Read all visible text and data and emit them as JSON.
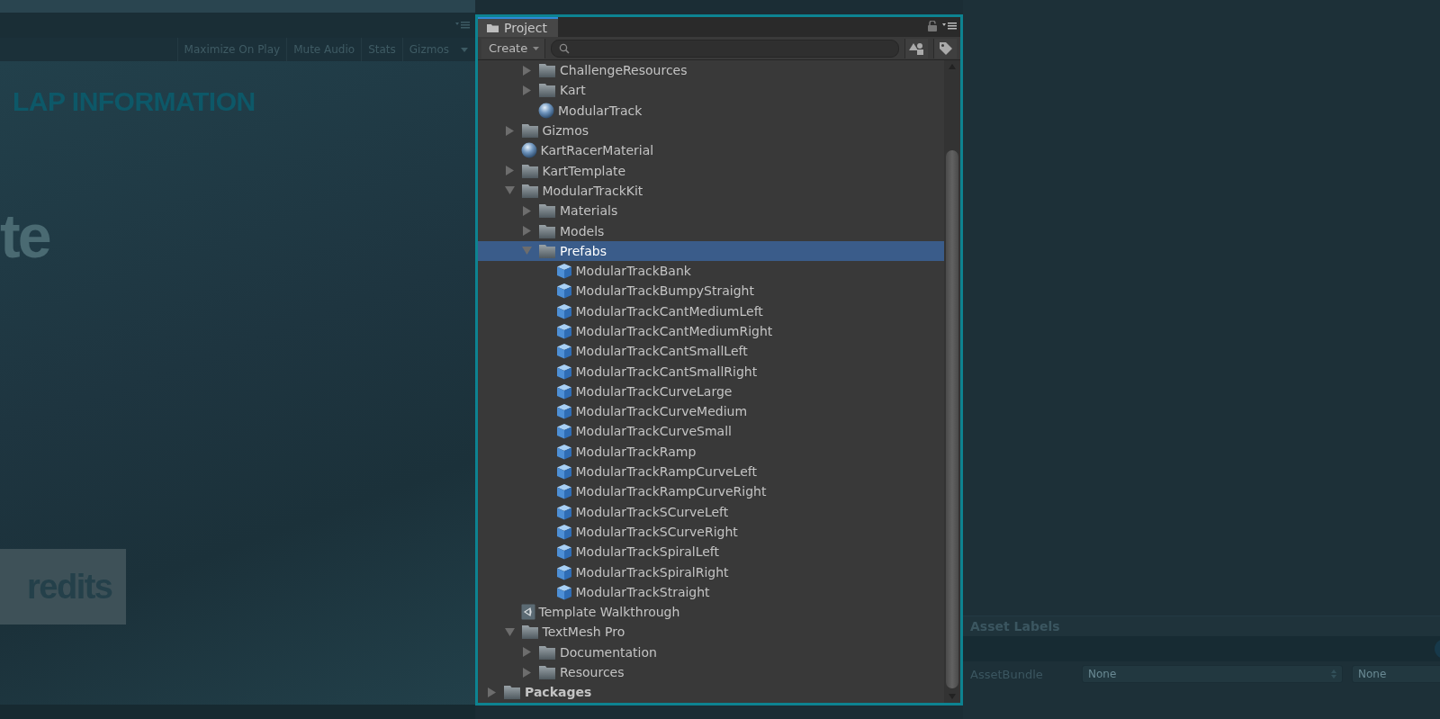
{
  "game_view": {
    "toolbar": [
      "Maximize On Play",
      "Mute Audio",
      "Stats",
      "Gizmos"
    ],
    "overlay_texts": [
      {
        "kind": "heading",
        "text": "LAP INFORMATION"
      },
      {
        "kind": "large",
        "text": "te"
      },
      {
        "kind": "button",
        "text": "redits"
      }
    ]
  },
  "project": {
    "tab": {
      "label": "Project",
      "selected": true
    },
    "create_label": "Create",
    "tree": [
      {
        "children": [
          {
            "children": [
              {
                "label": "ChallengeResources",
                "kind": "folder",
                "expanded": false,
                "selected": false
              },
              {
                "label": "Kart",
                "kind": "folder",
                "expanded": false,
                "selected": false
              },
              {
                "label": "ModularTrack",
                "kind": "material",
                "selected": false
              }
            ]
          },
          {
            "label": "Gizmos",
            "kind": "folder",
            "expanded": false,
            "selected": false
          },
          {
            "label": "KartRacerMaterial",
            "kind": "material",
            "selected": false
          },
          {
            "label": "KartTemplate",
            "kind": "folder",
            "expanded": false,
            "selected": false
          },
          {
            "label": "ModularTrackKit",
            "kind": "folder",
            "expanded": true,
            "selected": false,
            "children": [
              {
                "label": "Materials",
                "kind": "folder",
                "expanded": false,
                "selected": false
              },
              {
                "label": "Models",
                "kind": "folder",
                "expanded": false,
                "selected": false
              },
              {
                "label": "Prefabs",
                "kind": "folder",
                "expanded": true,
                "selected": true,
                "children": [
                  {
                    "label": "ModularTrackBank",
                    "kind": "prefab",
                    "selected": false
                  },
                  {
                    "label": "ModularTrackBumpyStraight",
                    "kind": "prefab",
                    "selected": false
                  },
                  {
                    "label": "ModularTrackCantMediumLeft",
                    "kind": "prefab",
                    "selected": false
                  },
                  {
                    "label": "ModularTrackCantMediumRight",
                    "kind": "prefab",
                    "selected": false
                  },
                  {
                    "label": "ModularTrackCantSmallLeft",
                    "kind": "prefab",
                    "selected": false
                  },
                  {
                    "label": "ModularTrackCantSmallRight",
                    "kind": "prefab",
                    "selected": false
                  },
                  {
                    "label": "ModularTrackCurveLarge",
                    "kind": "prefab",
                    "selected": false
                  },
                  {
                    "label": "ModularTrackCurveMedium",
                    "kind": "prefab",
                    "selected": false
                  },
                  {
                    "label": "ModularTrackCurveSmall",
                    "kind": "prefab",
                    "selected": false
                  },
                  {
                    "label": "ModularTrackRamp",
                    "kind": "prefab",
                    "selected": false
                  },
                  {
                    "label": "ModularTrackRampCurveLeft",
                    "kind": "prefab",
                    "selected": false
                  },
                  {
                    "label": "ModularTrackRampCurveRight",
                    "kind": "prefab",
                    "selected": false
                  },
                  {
                    "label": "ModularTrackSCurveLeft",
                    "kind": "prefab",
                    "selected": false
                  },
                  {
                    "label": "ModularTrackSCurveRight",
                    "kind": "prefab",
                    "selected": false
                  },
                  {
                    "label": "ModularTrackSpiralLeft",
                    "kind": "prefab",
                    "selected": false
                  },
                  {
                    "label": "ModularTrackSpiralRight",
                    "kind": "prefab",
                    "selected": false
                  },
                  {
                    "label": "ModularTrackStraight",
                    "kind": "prefab",
                    "selected": false
                  }
                ]
              }
            ]
          },
          {
            "label": "Template Walkthrough",
            "kind": "script",
            "selected": false
          },
          {
            "label": "TextMesh Pro",
            "kind": "folder",
            "expanded": true,
            "selected": false,
            "children": [
              {
                "label": "Documentation",
                "kind": "folder",
                "expanded": false,
                "selected": false
              },
              {
                "label": "Resources",
                "kind": "folder",
                "expanded": false,
                "selected": false
              }
            ]
          }
        ]
      },
      {
        "label": "Packages",
        "kind": "folder",
        "expanded": false,
        "selected": false
      }
    ]
  },
  "inspector": {
    "section_title": "Asset Labels",
    "asset_bundle": {
      "label": "AssetBundle",
      "values": [
        "None",
        "None"
      ]
    }
  }
}
